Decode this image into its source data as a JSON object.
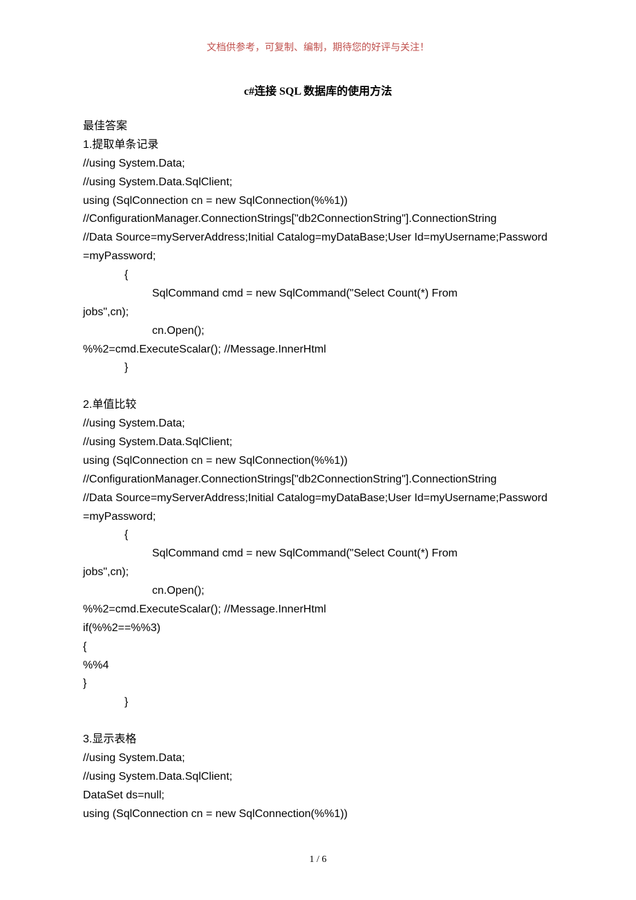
{
  "header_note": "文档供参考，可复制、编制，期待您的好评与关注！",
  "title": "c#连接 SQL 数据库的使用方法",
  "lines": [
    {
      "text": "最佳答案",
      "cls": "section-head"
    },
    {
      "text": "1.提取单条记录",
      "cls": "section-head"
    },
    {
      "text": "//using System.Data;"
    },
    {
      "text": "//using System.Data.SqlClient;"
    },
    {
      "text": "  using (SqlConnection cn = new SqlConnection(%%1))"
    },
    {
      "text": "//ConfigurationManager.ConnectionStrings[\"db2ConnectionString\"].ConnectionString"
    },
    {
      "text": "//Data Source=myServerAddress;Initial Catalog=myDataBase;User Id=myUsername;Password=myPassword;"
    },
    {
      "text": "{",
      "cls": "indent1"
    },
    {
      "text": "SqlCommand cmd = new SqlCommand(\"Select Count(*) From ",
      "cls": "indent2",
      "cont": true
    },
    {
      "text": "jobs\",cn);"
    },
    {
      "text": "cn.Open();",
      "cls": "indent2"
    },
    {
      "text": "%%2=cmd.ExecuteScalar(); //Message.InnerHtml"
    },
    {
      "text": "}",
      "cls": "indent1"
    },
    {
      "text": "",
      "cls": "spacer"
    },
    {
      "text": "2.单值比较",
      "cls": "section-head"
    },
    {
      "text": "//using System.Data;"
    },
    {
      "text": "//using System.Data.SqlClient;"
    },
    {
      "text": "using (SqlConnection cn = new SqlConnection(%%1))"
    },
    {
      "text": "//ConfigurationManager.ConnectionStrings[\"db2ConnectionString\"].ConnectionString"
    },
    {
      "text": "//Data Source=myServerAddress;Initial Catalog=myDataBase;User Id=myUsername;Password=myPassword;"
    },
    {
      "text": "{",
      "cls": "indent1"
    },
    {
      "text": "SqlCommand cmd = new SqlCommand(\"Select Count(*) From ",
      "cls": "indent2",
      "cont": true
    },
    {
      "text": "jobs\",cn);"
    },
    {
      "text": "cn.Open();",
      "cls": "indent2"
    },
    {
      "text": "%%2=cmd.ExecuteScalar(); //Message.InnerHtml"
    },
    {
      "text": "if(%%2==%%3)"
    },
    {
      "text": "{"
    },
    {
      "text": "%%4"
    },
    {
      "text": "}"
    },
    {
      "text": "}",
      "cls": "indent1"
    },
    {
      "text": "",
      "cls": "spacer"
    },
    {
      "text": "3.显示表格",
      "cls": "section-head"
    },
    {
      "text": "//using System.Data;"
    },
    {
      "text": "//using System.Data.SqlClient;"
    },
    {
      "text": "DataSet ds=null;"
    },
    {
      "text": "using (SqlConnection cn = new SqlConnection(%%1))"
    }
  ],
  "footer": "1 / 6"
}
